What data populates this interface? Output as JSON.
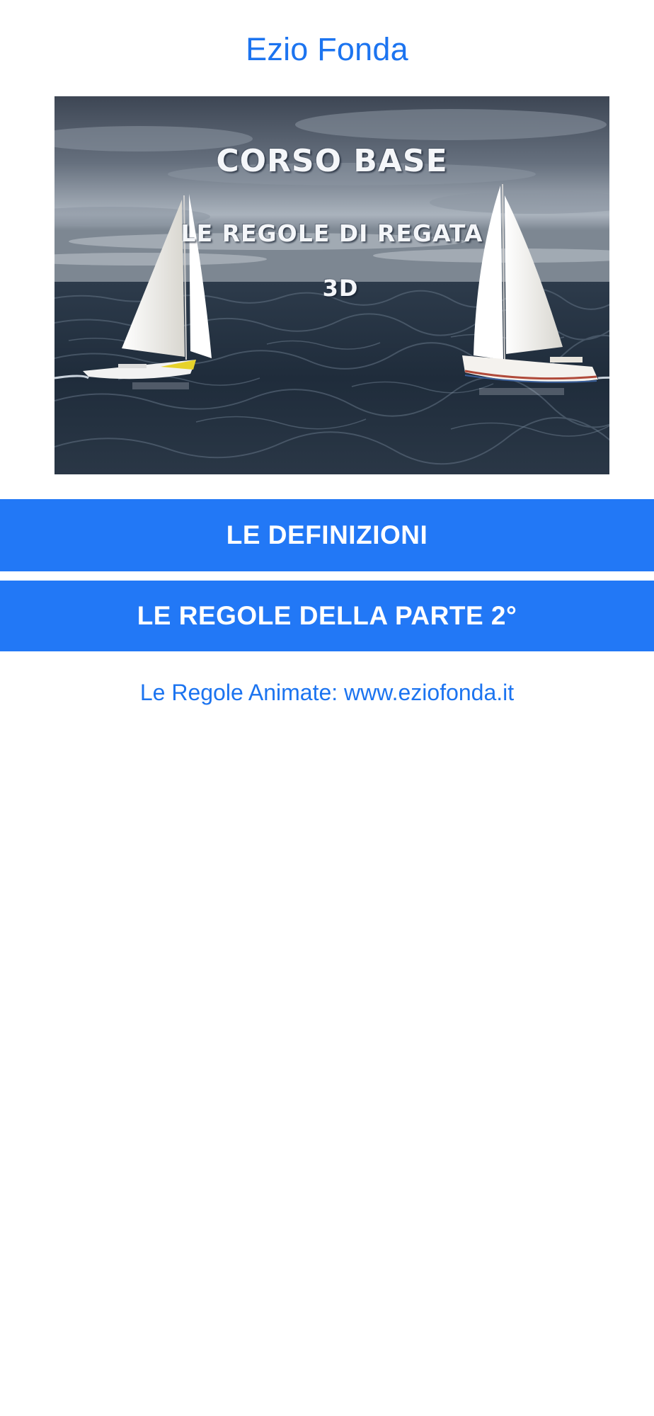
{
  "header": {
    "title": "Ezio Fonda"
  },
  "hero": {
    "line1": "CORSO BASE",
    "line2": "LE REGOLE DI REGATA",
    "line3": "3D"
  },
  "buttons": {
    "definitions": "LE DEFINIZIONI",
    "part2_rules": "LE REGOLE DELLA PARTE 2°"
  },
  "footer": {
    "link_text": "Le Regole Animate: www.eziofonda.it"
  },
  "colors": {
    "accent": "#1c74f0",
    "button_bg": "#2278f6",
    "background": "#ffffff"
  }
}
